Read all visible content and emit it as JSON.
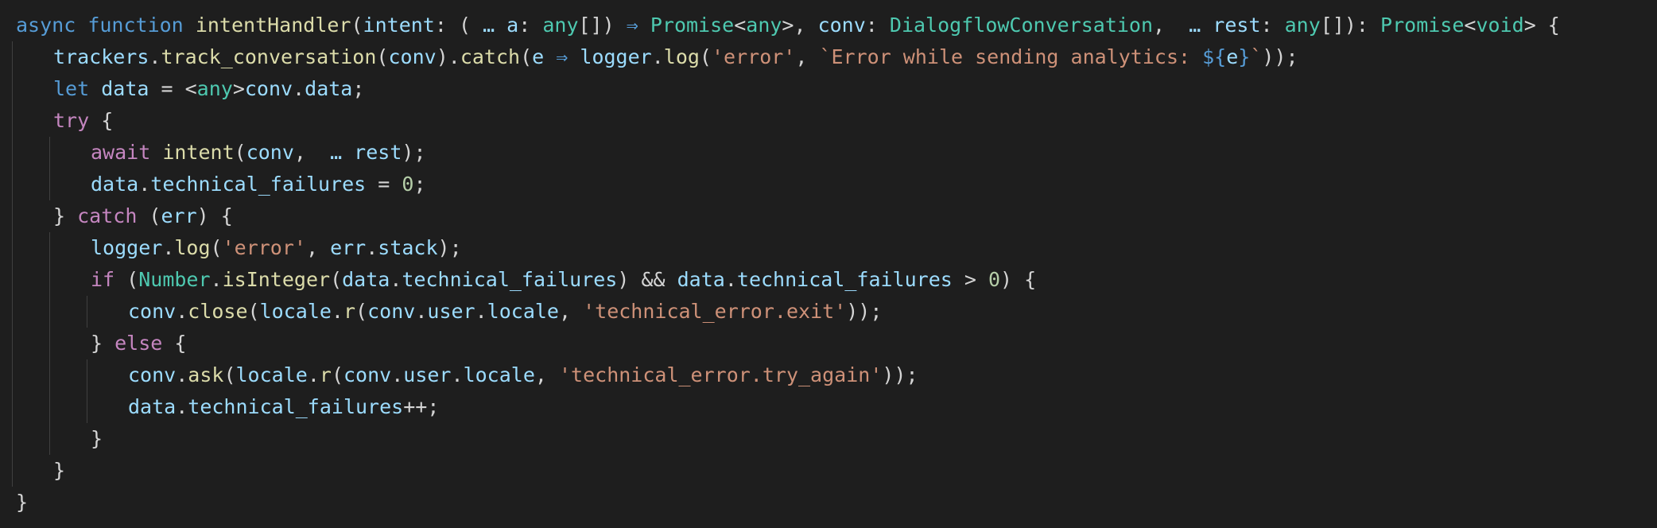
{
  "editor": {
    "theme_colors": {
      "background": "#1e1e1e",
      "keyword": "#569cd6",
      "control": "#c586c0",
      "function": "#dcdcaa",
      "variable": "#9cdcfe",
      "type": "#4ec9b0",
      "string": "#ce9178",
      "number": "#b5cea8",
      "punctuation": "#d4d4d4",
      "indent_guide": "#404040"
    },
    "lines": [
      {
        "indent": 0,
        "tokens": [
          [
            "kw",
            "async"
          ],
          [
            "op",
            " "
          ],
          [
            "kw",
            "function"
          ],
          [
            "op",
            " "
          ],
          [
            "fn",
            "intentHandler"
          ],
          [
            "op",
            "("
          ],
          [
            "var",
            "intent"
          ],
          [
            "op",
            ": ( "
          ],
          [
            "var",
            "… a"
          ],
          [
            "op",
            ": "
          ],
          [
            "type",
            "any"
          ],
          [
            "op",
            "[]) "
          ],
          [
            "kw",
            "⇒"
          ],
          [
            "op",
            " "
          ],
          [
            "type",
            "Promise"
          ],
          [
            "op",
            "<"
          ],
          [
            "type",
            "any"
          ],
          [
            "op",
            ">, "
          ],
          [
            "var",
            "conv"
          ],
          [
            "op",
            ": "
          ],
          [
            "type",
            "DialogflowConversation"
          ],
          [
            "op",
            ",  "
          ],
          [
            "var",
            "… rest"
          ],
          [
            "op",
            ": "
          ],
          [
            "type",
            "any"
          ],
          [
            "op",
            "[]): "
          ],
          [
            "type",
            "Promise"
          ],
          [
            "op",
            "<"
          ],
          [
            "type",
            "void"
          ],
          [
            "op",
            "> {"
          ]
        ]
      },
      {
        "indent": 1,
        "tokens": [
          [
            "var",
            "trackers"
          ],
          [
            "op",
            "."
          ],
          [
            "fn",
            "track_conversation"
          ],
          [
            "op",
            "("
          ],
          [
            "var",
            "conv"
          ],
          [
            "op",
            ")."
          ],
          [
            "fn",
            "catch"
          ],
          [
            "op",
            "("
          ],
          [
            "var",
            "e"
          ],
          [
            "op",
            " "
          ],
          [
            "kw",
            "⇒"
          ],
          [
            "op",
            " "
          ],
          [
            "var",
            "logger"
          ],
          [
            "op",
            "."
          ],
          [
            "fn",
            "log"
          ],
          [
            "op",
            "("
          ],
          [
            "str",
            "'error'"
          ],
          [
            "op",
            ", "
          ],
          [
            "str",
            "`Error while sending analytics: "
          ],
          [
            "kw",
            "${"
          ],
          [
            "var",
            "e"
          ],
          [
            "kw",
            "}"
          ],
          [
            "str",
            "`"
          ],
          [
            "op",
            "));"
          ]
        ]
      },
      {
        "indent": 1,
        "tokens": [
          [
            "kw",
            "let"
          ],
          [
            "op",
            " "
          ],
          [
            "var",
            "data"
          ],
          [
            "op",
            " = <"
          ],
          [
            "type",
            "any"
          ],
          [
            "op",
            ">"
          ],
          [
            "var",
            "conv"
          ],
          [
            "op",
            "."
          ],
          [
            "var",
            "data"
          ],
          [
            "op",
            ";"
          ]
        ]
      },
      {
        "indent": 1,
        "tokens": [
          [
            "ctl",
            "try"
          ],
          [
            "op",
            " {"
          ]
        ]
      },
      {
        "indent": 2,
        "tokens": [
          [
            "ctl",
            "await"
          ],
          [
            "op",
            " "
          ],
          [
            "fn",
            "intent"
          ],
          [
            "op",
            "("
          ],
          [
            "var",
            "conv"
          ],
          [
            "op",
            ",  "
          ],
          [
            "var",
            "… rest"
          ],
          [
            "op",
            ");"
          ]
        ]
      },
      {
        "indent": 2,
        "tokens": [
          [
            "var",
            "data"
          ],
          [
            "op",
            "."
          ],
          [
            "var",
            "technical_failures"
          ],
          [
            "op",
            " = "
          ],
          [
            "num",
            "0"
          ],
          [
            "op",
            ";"
          ]
        ]
      },
      {
        "indent": 1,
        "tokens": [
          [
            "op",
            "} "
          ],
          [
            "ctl",
            "catch"
          ],
          [
            "op",
            " ("
          ],
          [
            "var",
            "err"
          ],
          [
            "op",
            ") {"
          ]
        ]
      },
      {
        "indent": 2,
        "tokens": [
          [
            "var",
            "logger"
          ],
          [
            "op",
            "."
          ],
          [
            "fn",
            "log"
          ],
          [
            "op",
            "("
          ],
          [
            "str",
            "'error'"
          ],
          [
            "op",
            ", "
          ],
          [
            "var",
            "err"
          ],
          [
            "op",
            "."
          ],
          [
            "var",
            "stack"
          ],
          [
            "op",
            ");"
          ]
        ]
      },
      {
        "indent": 2,
        "tokens": [
          [
            "ctl",
            "if"
          ],
          [
            "op",
            " ("
          ],
          [
            "type",
            "Number"
          ],
          [
            "op",
            "."
          ],
          [
            "fn",
            "isInteger"
          ],
          [
            "op",
            "("
          ],
          [
            "var",
            "data"
          ],
          [
            "op",
            "."
          ],
          [
            "var",
            "technical_failures"
          ],
          [
            "op",
            ") && "
          ],
          [
            "var",
            "data"
          ],
          [
            "op",
            "."
          ],
          [
            "var",
            "technical_failures"
          ],
          [
            "op",
            " > "
          ],
          [
            "num",
            "0"
          ],
          [
            "op",
            ") {"
          ]
        ]
      },
      {
        "indent": 3,
        "tokens": [
          [
            "var",
            "conv"
          ],
          [
            "op",
            "."
          ],
          [
            "fn",
            "close"
          ],
          [
            "op",
            "("
          ],
          [
            "var",
            "locale"
          ],
          [
            "op",
            "."
          ],
          [
            "fn",
            "r"
          ],
          [
            "op",
            "("
          ],
          [
            "var",
            "conv"
          ],
          [
            "op",
            "."
          ],
          [
            "var",
            "user"
          ],
          [
            "op",
            "."
          ],
          [
            "var",
            "locale"
          ],
          [
            "op",
            ", "
          ],
          [
            "str",
            "'technical_error.exit'"
          ],
          [
            "op",
            "));"
          ]
        ]
      },
      {
        "indent": 2,
        "tokens": [
          [
            "op",
            "} "
          ],
          [
            "ctl",
            "else"
          ],
          [
            "op",
            " {"
          ]
        ]
      },
      {
        "indent": 3,
        "tokens": [
          [
            "var",
            "conv"
          ],
          [
            "op",
            "."
          ],
          [
            "fn",
            "ask"
          ],
          [
            "op",
            "("
          ],
          [
            "var",
            "locale"
          ],
          [
            "op",
            "."
          ],
          [
            "fn",
            "r"
          ],
          [
            "op",
            "("
          ],
          [
            "var",
            "conv"
          ],
          [
            "op",
            "."
          ],
          [
            "var",
            "user"
          ],
          [
            "op",
            "."
          ],
          [
            "var",
            "locale"
          ],
          [
            "op",
            ", "
          ],
          [
            "str",
            "'technical_error.try_again'"
          ],
          [
            "op",
            "));"
          ]
        ]
      },
      {
        "indent": 3,
        "tokens": [
          [
            "var",
            "data"
          ],
          [
            "op",
            "."
          ],
          [
            "var",
            "technical_failures"
          ],
          [
            "op",
            "++;"
          ]
        ]
      },
      {
        "indent": 2,
        "tokens": [
          [
            "op",
            "}"
          ]
        ]
      },
      {
        "indent": 1,
        "tokens": [
          [
            "op",
            "}"
          ]
        ]
      },
      {
        "indent": 0,
        "tokens": [
          [
            "op",
            "}"
          ]
        ]
      }
    ]
  }
}
